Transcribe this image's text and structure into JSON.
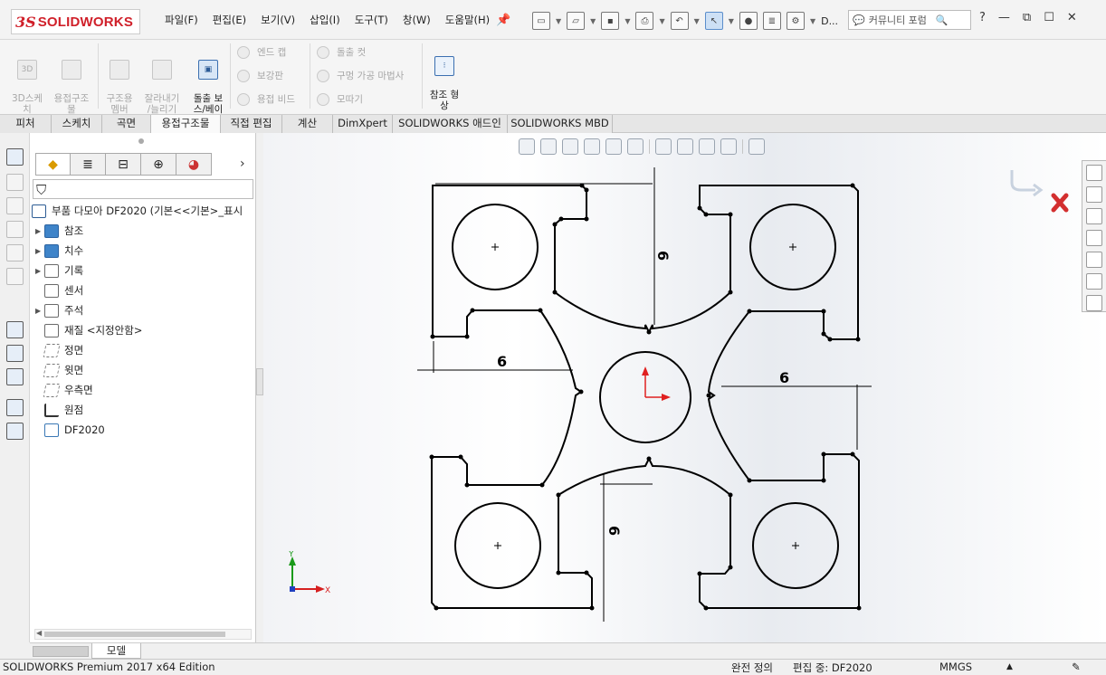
{
  "app": {
    "logo": "SOLIDWORKS",
    "logo_prefix": "3S"
  },
  "menu": [
    "파일(F)",
    "편집(E)",
    "보기(V)",
    "삽입(I)",
    "도구(T)",
    "창(W)",
    "도움말(H)"
  ],
  "toolbar": {
    "d_label": "D...",
    "forum_placeholder": "커뮤니티 포럼"
  },
  "ribbon": {
    "sketch3d": "3D스케\n치",
    "weld_structure": "용접구조\n물",
    "structural_member": "구조용\n멤버",
    "trim_extend": "잘라내기\n/늘리기",
    "extrude_boss": "돌출 보\n스/베이\n스",
    "end_cap": "엔드 캡",
    "gusset": "보강판",
    "weld_bead": "용접 비드",
    "extrude_cut": "돌출 컷",
    "hole_wizard": "구멍 가공 마법사",
    "chamfer": "모따기",
    "ref_geometry": "참조 형\n상"
  },
  "tabs": [
    "피처",
    "스케치",
    "곡면",
    "용접구조물",
    "직접 편집",
    "계산",
    "DimXpert",
    "SOLIDWORKS 애드인",
    "SOLIDWORKS MBD"
  ],
  "active_tab": "용접구조물",
  "feature_tree": {
    "root": "부품 다모아 DF2020  (기본<<기본>_표시",
    "items": [
      {
        "label": "참조",
        "expandable": true,
        "icon": "folder-icon"
      },
      {
        "label": "치수",
        "expandable": true,
        "icon": "folder-icon"
      },
      {
        "label": "기록",
        "expandable": true,
        "icon": "history-icon"
      },
      {
        "label": "센서",
        "expandable": false,
        "icon": "sensor-icon"
      },
      {
        "label": "주석",
        "expandable": true,
        "icon": "annotation-icon"
      },
      {
        "label": "재질 <지정안함>",
        "expandable": false,
        "icon": "material-icon"
      },
      {
        "label": "정면",
        "expandable": false,
        "icon": "plane-icon"
      },
      {
        "label": "윗면",
        "expandable": false,
        "icon": "plane-icon"
      },
      {
        "label": "우측면",
        "expandable": false,
        "icon": "plane-icon"
      },
      {
        "label": "원점",
        "expandable": false,
        "icon": "origin-icon"
      },
      {
        "label": "DF2020",
        "expandable": false,
        "icon": "sketch-icon"
      }
    ]
  },
  "model_tab": "모델",
  "sketch": {
    "dimensions": [
      "6",
      "6",
      "6",
      "6"
    ],
    "triad": {
      "y": "Y",
      "x": "X"
    }
  },
  "status": {
    "edition": "SOLIDWORKS Premium 2017 x64 Edition",
    "definition": "완전 정의",
    "editing": "편집 중: DF2020",
    "units": "MMGS",
    "units_arrow": "▲"
  },
  "colors": {
    "accent": "#2a6fc9",
    "brand": "#d0202a",
    "cancel": "#d32f2f",
    "sketch": "#000000"
  }
}
